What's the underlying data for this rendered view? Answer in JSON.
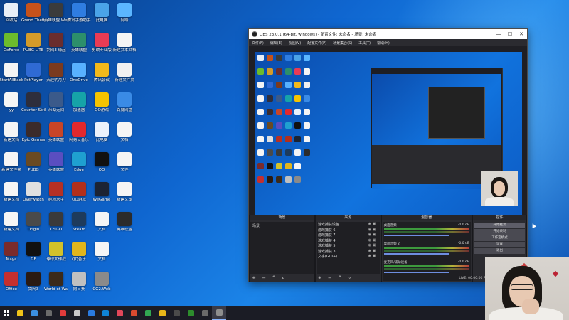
{
  "desktop": {
    "icons": [
      {
        "label": "回收站",
        "color": "#e8eef7",
        "col": 0,
        "row": 0
      },
      {
        "label": "Grand Theft Auto",
        "color": "#c6521b",
        "col": 1,
        "row": 0
      },
      {
        "label": "英雄联盟 WeGame",
        "color": "#3b3b3b",
        "col": 2,
        "row": 0
      },
      {
        "label": "腾讯手游助手",
        "color": "#2f7de1",
        "col": 3,
        "row": 0
      },
      {
        "label": "此电脑",
        "color": "#4aa3e8",
        "col": 4,
        "row": 0
      },
      {
        "label": "网络",
        "color": "#5bb6ff",
        "col": 5,
        "row": 0
      },
      {
        "label": "GeForce",
        "color": "#6cbb2c",
        "col": 0,
        "row": 1
      },
      {
        "label": "PUBG LITE",
        "color": "#d49b2a",
        "col": 1,
        "row": 1
      },
      {
        "label": "剑网3 缘起",
        "color": "#6a2d2d",
        "col": 2,
        "row": 1
      },
      {
        "label": "英雄联盟",
        "color": "#2c8f6b",
        "col": 3,
        "row": 1
      },
      {
        "label": "剪映专业版",
        "color": "#e93b55",
        "col": 4,
        "row": 1
      },
      {
        "label": "新建文本文档",
        "color": "#f5f5f5",
        "col": 5,
        "row": 1
      },
      {
        "label": "StartAllBack",
        "color": "#f4f4f4",
        "col": 0,
        "row": 2
      },
      {
        "label": "PotPlayer",
        "color": "#2f6ad4",
        "col": 1,
        "row": 2
      },
      {
        "label": "天涯明月刀",
        "color": "#7b3a1e",
        "col": 2,
        "row": 2
      },
      {
        "label": "OneDrive",
        "color": "#58b1ff",
        "col": 3,
        "row": 2
      },
      {
        "label": "腾讯会议",
        "color": "#f2b91b",
        "col": 4,
        "row": 2
      },
      {
        "label": "新建文件夹",
        "color": "#f1f1f1",
        "col": 5,
        "row": 2
      },
      {
        "label": "yy",
        "color": "#f5f5f5",
        "col": 0,
        "row": 3
      },
      {
        "label": "Counter-Strike",
        "color": "#2e2e3c",
        "col": 1,
        "row": 3
      },
      {
        "label": "永劫无间",
        "color": "#3b5a8a",
        "col": 2,
        "row": 3
      },
      {
        "label": "加速器",
        "color": "#16a3a8",
        "col": 3,
        "row": 3
      },
      {
        "label": "QQ游戏",
        "color": "#f5c400",
        "col": 4,
        "row": 3
      },
      {
        "label": "百度网盘",
        "color": "#3a8be6",
        "col": 5,
        "row": 3
      },
      {
        "label": "新建文档",
        "color": "#f5f5f5",
        "col": 0,
        "row": 4
      },
      {
        "label": "Epic Games",
        "color": "#3b2b2b",
        "col": 1,
        "row": 4
      },
      {
        "label": "英雄联盟",
        "color": "#c84527",
        "col": 2,
        "row": 4
      },
      {
        "label": "网易云音乐",
        "color": "#e2282d",
        "col": 3,
        "row": 4
      },
      {
        "label": "此电脑",
        "color": "#eaf1fb",
        "col": 4,
        "row": 4
      },
      {
        "label": "文档",
        "color": "#f5f5f5",
        "col": 5,
        "row": 4
      },
      {
        "label": "新建文件夹",
        "color": "#f5f5f5",
        "col": 0,
        "row": 5
      },
      {
        "label": "PUBG",
        "color": "#6a4a22",
        "col": 1,
        "row": 5
      },
      {
        "label": "英雄联盟",
        "color": "#5a4ec0",
        "col": 2,
        "row": 5
      },
      {
        "label": "Edge",
        "color": "#1fa0d0",
        "col": 3,
        "row": 5
      },
      {
        "label": "QQ",
        "color": "#111111",
        "col": 4,
        "row": 5
      },
      {
        "label": "文件",
        "color": "#f5f5f5",
        "col": 5,
        "row": 5
      },
      {
        "label": "新建文档",
        "color": "#f5f5f5",
        "col": 0,
        "row": 6
      },
      {
        "label": "Overwatch",
        "color": "#e0e0e0",
        "col": 1,
        "row": 6
      },
      {
        "label": "绝地求生",
        "color": "#b53024",
        "col": 2,
        "row": 6
      },
      {
        "label": "QQ游戏",
        "color": "#b22f1c",
        "col": 3,
        "row": 6
      },
      {
        "label": "WeGame",
        "color": "#1c2333",
        "col": 4,
        "row": 6
      },
      {
        "label": "新建文本",
        "color": "#f5f5f5",
        "col": 5,
        "row": 6
      },
      {
        "label": "新建文档",
        "color": "#f5f5f5",
        "col": 0,
        "row": 7
      },
      {
        "label": "Origin",
        "color": "#4a4a4a",
        "col": 1,
        "row": 7
      },
      {
        "label": "CSGO",
        "color": "#3a3a3a",
        "col": 2,
        "row": 7
      },
      {
        "label": "Steam",
        "color": "#1e3b5c",
        "col": 3,
        "row": 7
      },
      {
        "label": "文档",
        "color": "#f5f5f5",
        "col": 4,
        "row": 7
      },
      {
        "label": "英雄联盟",
        "color": "#2b2b2b",
        "col": 5,
        "row": 7
      },
      {
        "label": "Maya",
        "color": "#7a2b2b",
        "col": 0,
        "row": 8
      },
      {
        "label": "GF",
        "color": "#111111",
        "col": 1,
        "row": 8
      },
      {
        "label": "球球大作战",
        "color": "#d2c22a",
        "col": 2,
        "row": 8
      },
      {
        "label": "QQ音乐",
        "color": "#e1b61c",
        "col": 3,
        "row": 8
      },
      {
        "label": "文档",
        "color": "#f5f5f5",
        "col": 4,
        "row": 8
      },
      {
        "label": "Office",
        "color": "#c52f2f",
        "col": 0,
        "row": 9
      },
      {
        "label": "剑网3",
        "color": "#2a1a12",
        "col": 1,
        "row": 9
      },
      {
        "label": "World of Warcraft",
        "color": "#3b2a1a",
        "col": 2,
        "row": 9
      },
      {
        "label": "向日葵",
        "color": "#c0c0c0",
        "col": 3,
        "row": 9
      },
      {
        "label": "CG2.Web",
        "color": "#8a8a8a",
        "col": 4,
        "row": 9
      }
    ]
  },
  "obs": {
    "title": "OBS 23.0.1 (64-bit, windows) - 配置文件: 未命名 - 场景: 未命名",
    "window_controls": {
      "minimize": "—",
      "maximize": "☐",
      "close": "✕"
    },
    "menu": [
      "文件(F)",
      "编辑(E)",
      "视图(V)",
      "配置文件(P)",
      "场景集合(S)",
      "工具(T)",
      "帮助(H)"
    ],
    "docks": {
      "scenes_header": "场景",
      "sources_header": "来源",
      "mixer_header": "混音器",
      "controls_header": "控件",
      "scenes": [
        "场景"
      ],
      "sources": [
        "游戏捕获设备",
        "游戏捕获 6",
        "游戏捕获 7",
        "游戏捕获 4",
        "游戏捕获 5",
        "游戏捕获 3",
        "文字(GDI+)"
      ],
      "mixer_tracks": [
        {
          "name": "桌面音频",
          "db": "-0.0 dB"
        },
        {
          "name": "桌面音频 2",
          "db": "-0.0 dB"
        },
        {
          "name": "麦克风/辅助设备",
          "db": "-0.0 dB"
        }
      ],
      "controls": [
        "开始推流",
        "开始录制",
        "工作室模式",
        "设置",
        "退出"
      ],
      "dock_footer": "+ − ^ v",
      "status": "LIVE: 00:00:00   REC: 00:00:00   CPU: 0.9%"
    }
  },
  "taskbar": {
    "apps": [
      "#f0c419",
      "#3b8fe0",
      "#6b6b6b",
      "#e23b3b",
      "#c9c9c9",
      "#2a7be0",
      "#0f84d6",
      "#e0475a",
      "#d94a2f",
      "#32a852",
      "#e7b619",
      "#4b4b4b",
      "#2d8c2d",
      "#6a6a6a",
      "#8e8e8e"
    ]
  }
}
